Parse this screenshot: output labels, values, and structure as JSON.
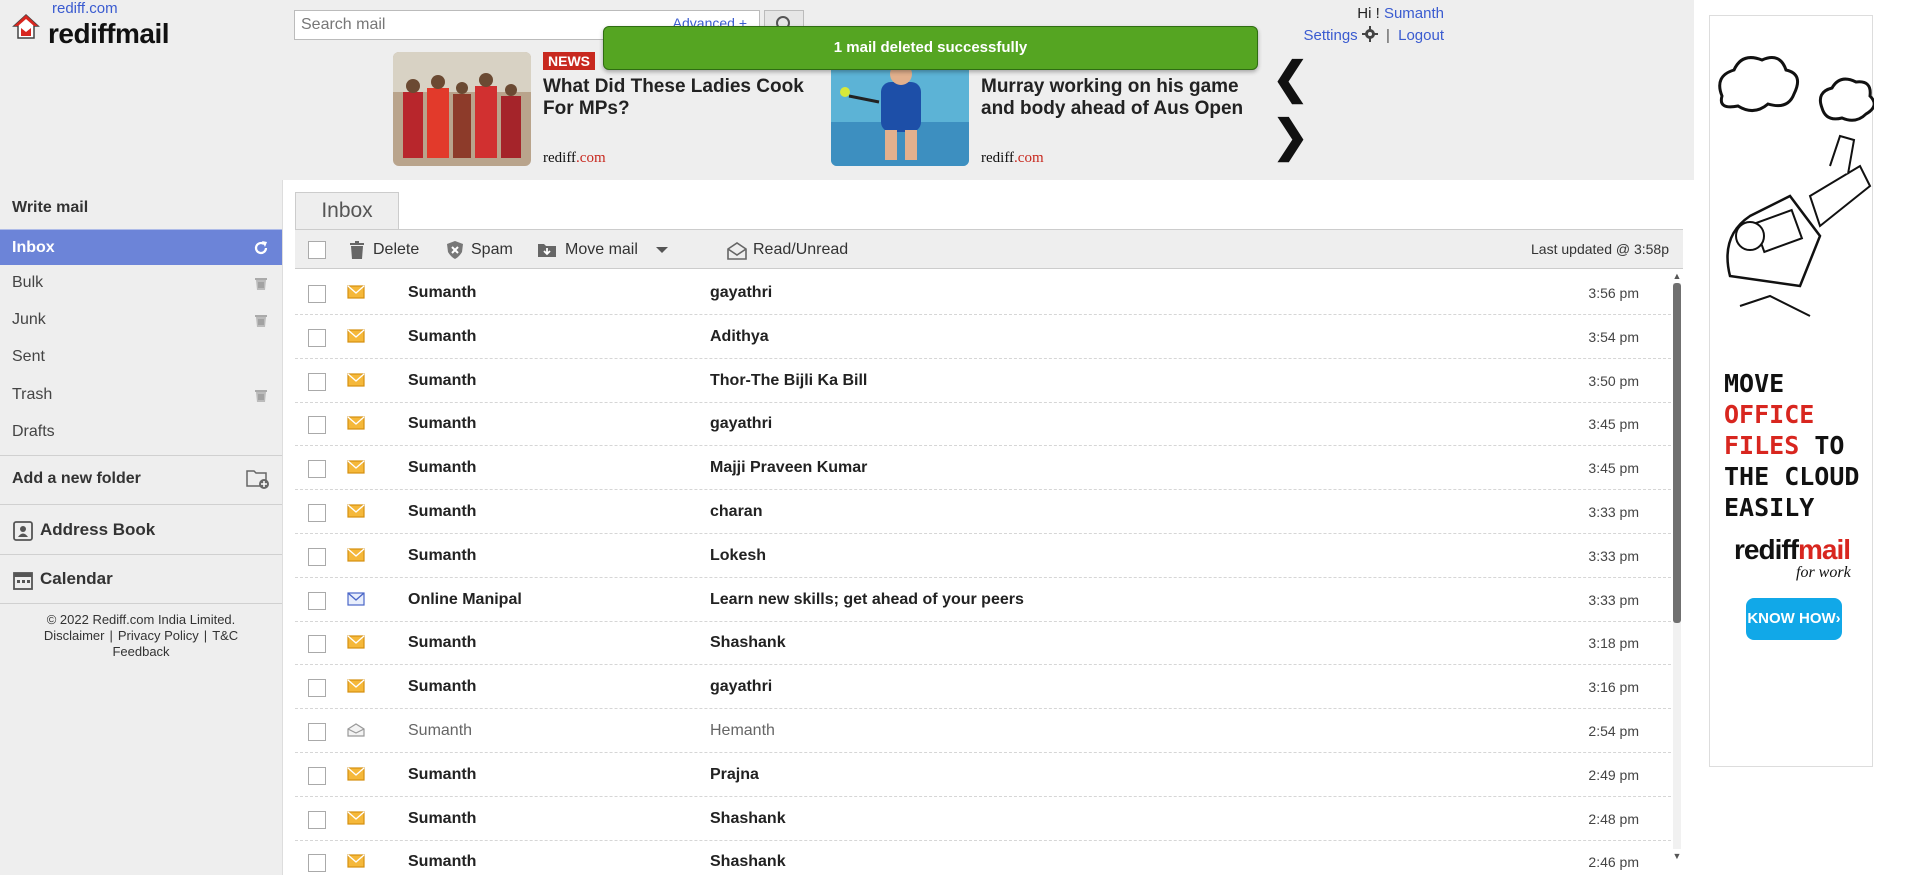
{
  "header": {
    "site_link": "rediff.com",
    "brand": "rediffmail",
    "search_placeholder": "Search mail",
    "advanced_label": "Advanced +",
    "toast": "1 mail deleted successfully",
    "greeting": "Hi ! ",
    "user_name": "Sumanth",
    "settings_label": "Settings",
    "logout_label": "Logout",
    "news": [
      {
        "badge": "NEWS",
        "headline": "What Did These Ladies Cook For MPs?",
        "source_name": "rediff",
        "source_domain": ".com"
      },
      {
        "badge": "",
        "headline": "Murray working on his game and body ahead of Aus Open",
        "source_name": "rediff",
        "source_domain": ".com"
      }
    ],
    "nav_prev": "❮",
    "nav_next": "❯"
  },
  "sidebar": {
    "write_mail": "Write mail",
    "folders": [
      {
        "label": "Inbox",
        "icon": "refresh-icon"
      },
      {
        "label": "Bulk",
        "icon": "trash-icon"
      },
      {
        "label": "Junk",
        "icon": "trash-icon"
      },
      {
        "label": "Sent",
        "icon": ""
      },
      {
        "label": "Trash",
        "icon": "trash-icon"
      },
      {
        "label": "Drafts",
        "icon": ""
      }
    ],
    "add_folder": "Add a new folder",
    "address_book": "Address Book",
    "calendar": "Calendar",
    "footer": {
      "copyright": "© 2022 Rediff.com India Limited.",
      "disclaimer": "Disclaimer",
      "privacy": "Privacy Policy",
      "tc": "T&C",
      "feedback": "Feedback"
    }
  },
  "main": {
    "tab": "Inbox",
    "toolbar": {
      "delete": "Delete",
      "spam": "Spam",
      "move": "Move mail",
      "read_unread": "Read/Unread",
      "last_updated": "Last updated  @ 3:58p"
    },
    "mails": [
      {
        "from": "Sumanth",
        "subject": "gayathri",
        "time": "3:56 pm",
        "status": "unread"
      },
      {
        "from": "Sumanth",
        "subject": "Adithya",
        "time": "3:54 pm",
        "status": "unread"
      },
      {
        "from": "Sumanth",
        "subject": "Thor-The Bijli Ka Bill",
        "time": "3:50 pm",
        "status": "unread"
      },
      {
        "from": "Sumanth",
        "subject": "gayathri",
        "time": "3:45 pm",
        "status": "unread"
      },
      {
        "from": "Sumanth",
        "subject": "Majji Praveen Kumar",
        "time": "3:45 pm",
        "status": "unread"
      },
      {
        "from": "Sumanth",
        "subject": "charan",
        "time": "3:33 pm",
        "status": "unread"
      },
      {
        "from": "Sumanth",
        "subject": "Lokesh",
        "time": "3:33 pm",
        "status": "unread"
      },
      {
        "from": "Online Manipal",
        "subject": "Learn new skills; get ahead of your peers",
        "time": "3:33 pm",
        "status": "unread-blue"
      },
      {
        "from": "Sumanth",
        "subject": "Shashank",
        "time": "3:18 pm",
        "status": "unread"
      },
      {
        "from": "Sumanth",
        "subject": "gayathri",
        "time": "3:16 pm",
        "status": "unread"
      },
      {
        "from": "Sumanth",
        "subject": "Hemanth",
        "time": "2:54 pm",
        "status": "read"
      },
      {
        "from": "Sumanth",
        "subject": "Prajna",
        "time": "2:49 pm",
        "status": "unread"
      },
      {
        "from": "Sumanth",
        "subject": "Shashank",
        "time": "2:48 pm",
        "status": "unread"
      },
      {
        "from": "Sumanth",
        "subject": "Shashank",
        "time": "2:46 pm",
        "status": "unread"
      }
    ]
  },
  "ad": {
    "line1a": "MOVE ",
    "line1b": "OFFICE",
    "line2a": "FILES",
    "line2b": " TO",
    "line3": "THE CLOUD",
    "line4": "EASILY",
    "brand_a": "rediff",
    "brand_b": "mail",
    "sub": "for work",
    "cta": "KNOW HOW›"
  },
  "colors": {
    "active_folder": "#6c84d8",
    "toast_bg": "#55a522",
    "link": "#3a5bd0",
    "news_badge": "#c8291f",
    "ad_cta": "#11a8e8"
  }
}
